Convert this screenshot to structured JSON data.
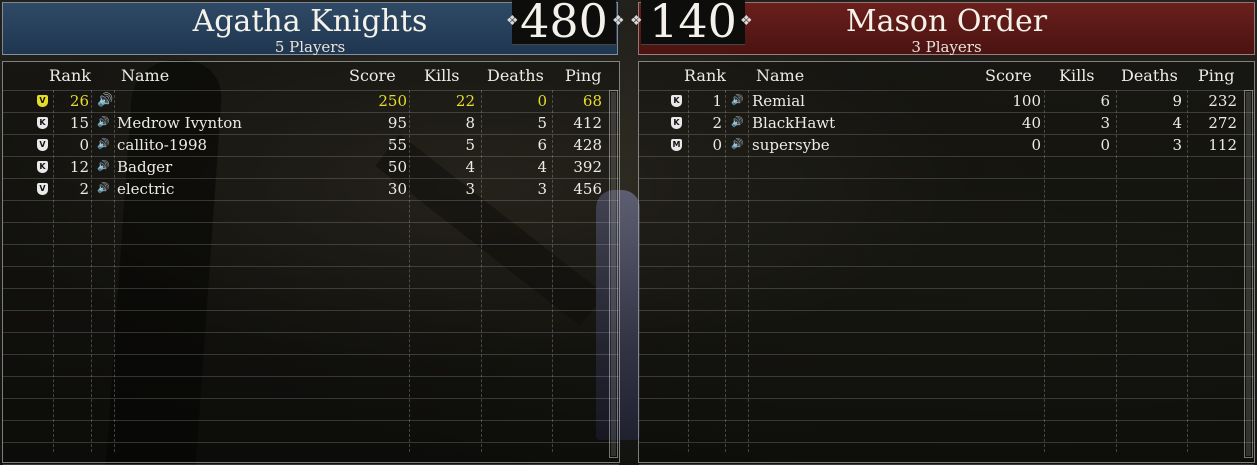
{
  "teams": {
    "left": {
      "name": "Agatha Knights",
      "players_label": "5 Players",
      "score": "480",
      "color": "#2f4a66"
    },
    "right": {
      "name": "Mason Order",
      "players_label": "3 Players",
      "score": "140",
      "color": "#6a1f1c"
    }
  },
  "columns": {
    "rank": "Rank",
    "name": "Name",
    "score": "Score",
    "kills": "Kills",
    "deaths": "Deaths",
    "ping": "Ping"
  },
  "highlight_color": "#e6dd2a",
  "left_players": [
    {
      "badge": "V",
      "rank": "26",
      "name": "",
      "score": "250",
      "kills": "22",
      "deaths": "0",
      "ping": "68",
      "is_self": true
    },
    {
      "badge": "K",
      "rank": "15",
      "name": "Medrow Ivynton",
      "score": "95",
      "kills": "8",
      "deaths": "5",
      "ping": "412"
    },
    {
      "badge": "V",
      "rank": "0",
      "name": "callito-1998",
      "score": "55",
      "kills": "5",
      "deaths": "6",
      "ping": "428"
    },
    {
      "badge": "K",
      "rank": "12",
      "name": "Badger",
      "score": "50",
      "kills": "4",
      "deaths": "4",
      "ping": "392"
    },
    {
      "badge": "V",
      "rank": "2",
      "name": "electric",
      "score": "30",
      "kills": "3",
      "deaths": "3",
      "ping": "456"
    }
  ],
  "right_players": [
    {
      "badge": "K",
      "rank": "1",
      "name": "Remial",
      "score": "100",
      "kills": "6",
      "deaths": "9",
      "ping": "232"
    },
    {
      "badge": "K",
      "rank": "2",
      "name": "BlackHawt",
      "score": "40",
      "kills": "3",
      "deaths": "4",
      "ping": "272"
    },
    {
      "badge": "M",
      "rank": "0",
      "name": "supersybe",
      "score": "0",
      "kills": "0",
      "deaths": "3",
      "ping": "112"
    }
  ]
}
